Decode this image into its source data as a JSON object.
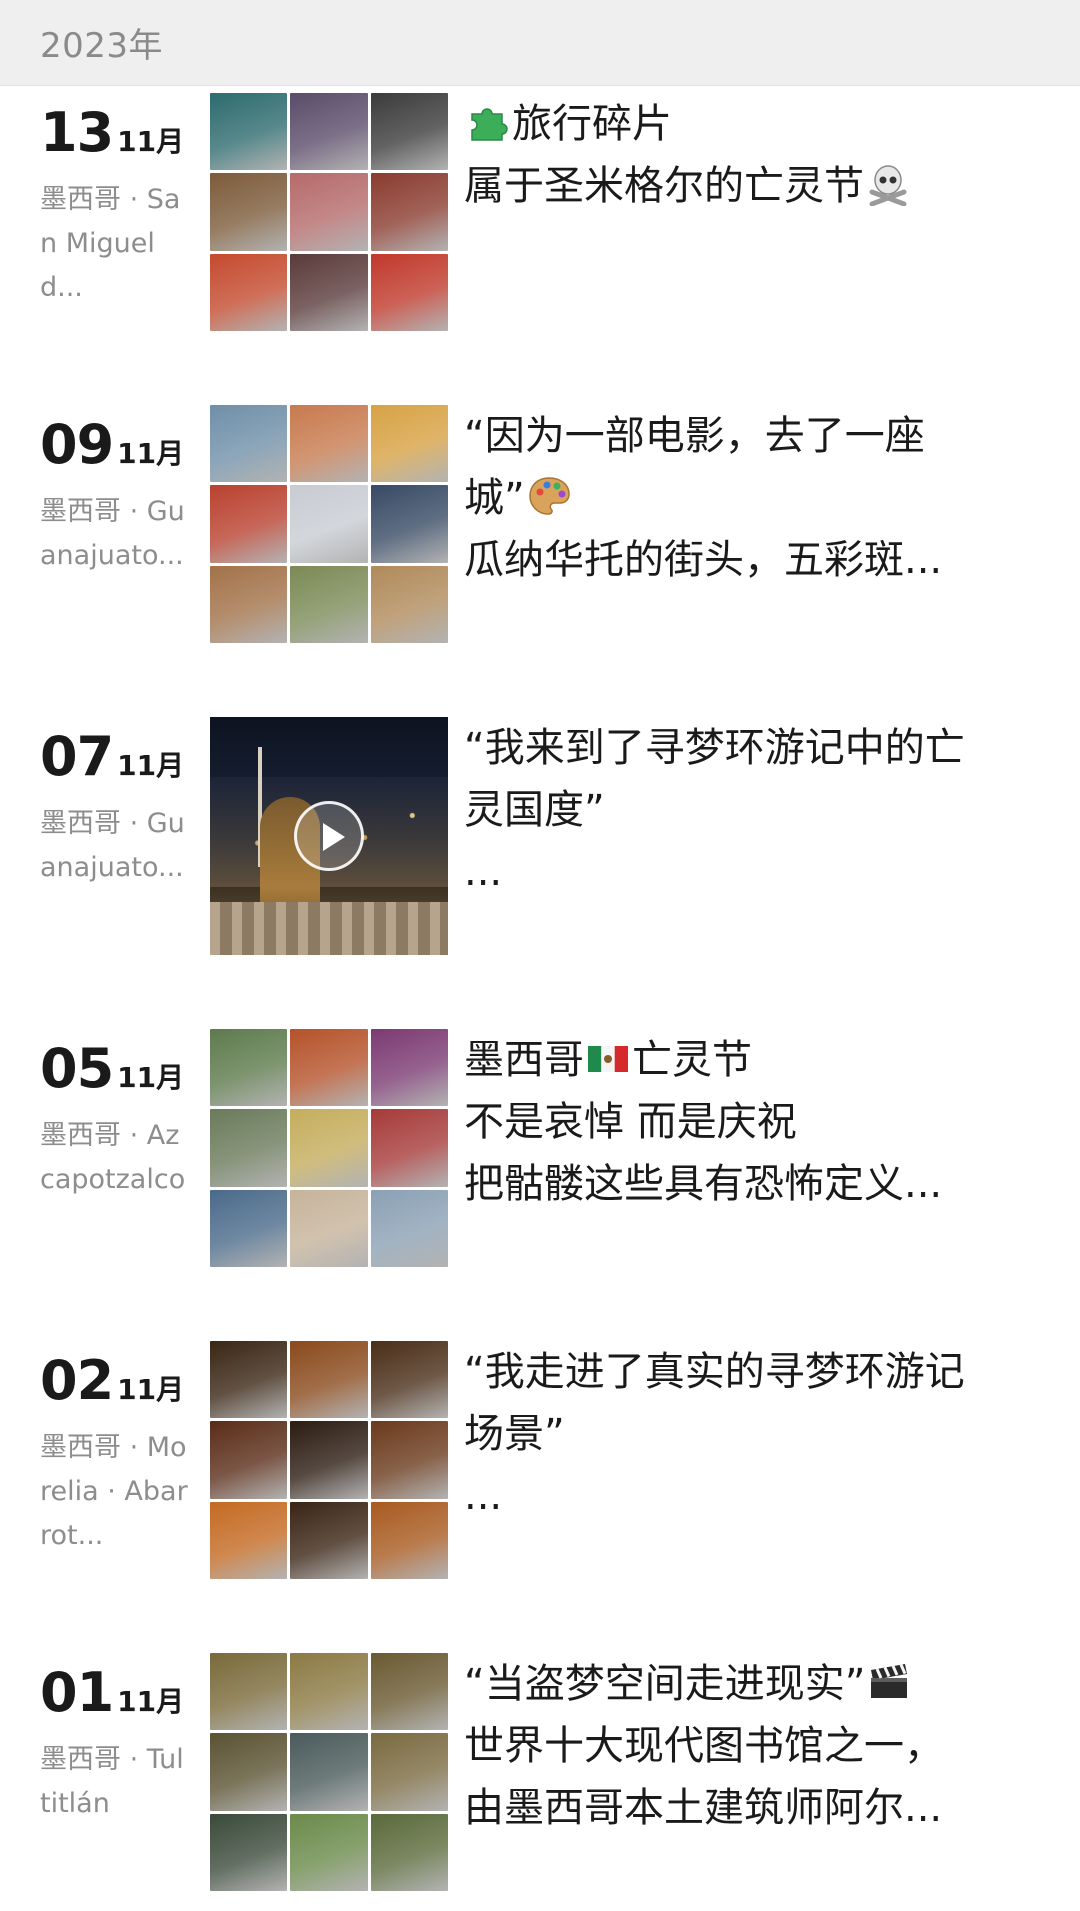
{
  "header": {
    "year": "2023年"
  },
  "entries": [
    {
      "day": "13",
      "month": "11月",
      "location": "墨西哥 · San Miguel d...",
      "media": "grid",
      "lines": [
        "旅行碎片",
        "属于圣米格尔的亡灵节"
      ],
      "icons": [
        "puzzle-icon",
        "skull-crossbones-icon"
      ],
      "palette": [
        "#2d6b6e",
        "#5a4c6a",
        "#3b3b3b",
        "#7c5b3a",
        "#b56a6a",
        "#8a3b2f",
        "#c44a2e",
        "#5a3a3a",
        "#c0392b"
      ]
    },
    {
      "day": "09",
      "month": "11月",
      "location": "墨西哥 · Guanajuato...",
      "media": "grid",
      "lines": [
        "“因为一部电影，去了一座",
        "城”",
        "瓜纳华托的街头，五彩斑..."
      ],
      "icons": [
        "palette-icon"
      ],
      "palette": [
        "#6f8fa8",
        "#c77a4e",
        "#d7a244",
        "#b9412f",
        "#c8ccd2",
        "#374a64",
        "#a27249",
        "#7b8a56",
        "#b08a5a"
      ]
    },
    {
      "day": "07",
      "month": "11月",
      "location": "墨西哥 · Guanajuato...",
      "media": "video",
      "lines": [
        "“我来到了寻梦环游记中的亡",
        "灵国度”",
        "..."
      ],
      "icons": [
        "play-icon"
      ]
    },
    {
      "day": "05",
      "month": "11月",
      "location": "墨西哥 · Azcapotzalco",
      "media": "grid",
      "lines": [
        "墨西哥",
        "亡灵节",
        "不是哀悼 而是庆祝",
        "把骷髅这些具有恐怖定义..."
      ],
      "icons": [
        "mexico-flag-icon"
      ],
      "palette": [
        "#5d7a4c",
        "#b5522a",
        "#7b3a72",
        "#6a7a5a",
        "#c4ad5c",
        "#a63a3a",
        "#4a6a8a",
        "#c6b39a",
        "#8aa0b4"
      ]
    },
    {
      "day": "02",
      "month": "11月",
      "location": "墨西哥 · Morelia · Abarrot...",
      "media": "grid",
      "lines": [
        "“我走进了真实的寻梦环游记",
        "场景”",
        "..."
      ],
      "icons": [],
      "palette": [
        "#3a2614",
        "#8a4a1c",
        "#4a2e18",
        "#5a2c18",
        "#2c1c12",
        "#6a3a1c",
        "#c46a22",
        "#3a2414",
        "#a85a20"
      ]
    },
    {
      "day": "01",
      "month": "11月",
      "location": "墨西哥 · Tultitlán",
      "media": "grid",
      "lines": [
        "“当盗梦空间走进现实”",
        "世界十大现代图书馆之一，",
        "由墨西哥本土建筑师阿尔..."
      ],
      "icons": [
        "clapperboard-icon"
      ],
      "palette": [
        "#7a6a3a",
        "#8c7a44",
        "#6a5a32",
        "#5a5232",
        "#4a5a5a",
        "#7a6a40",
        "#3a4a3a",
        "#6a8a4a",
        "#5a6a3a"
      ]
    }
  ]
}
